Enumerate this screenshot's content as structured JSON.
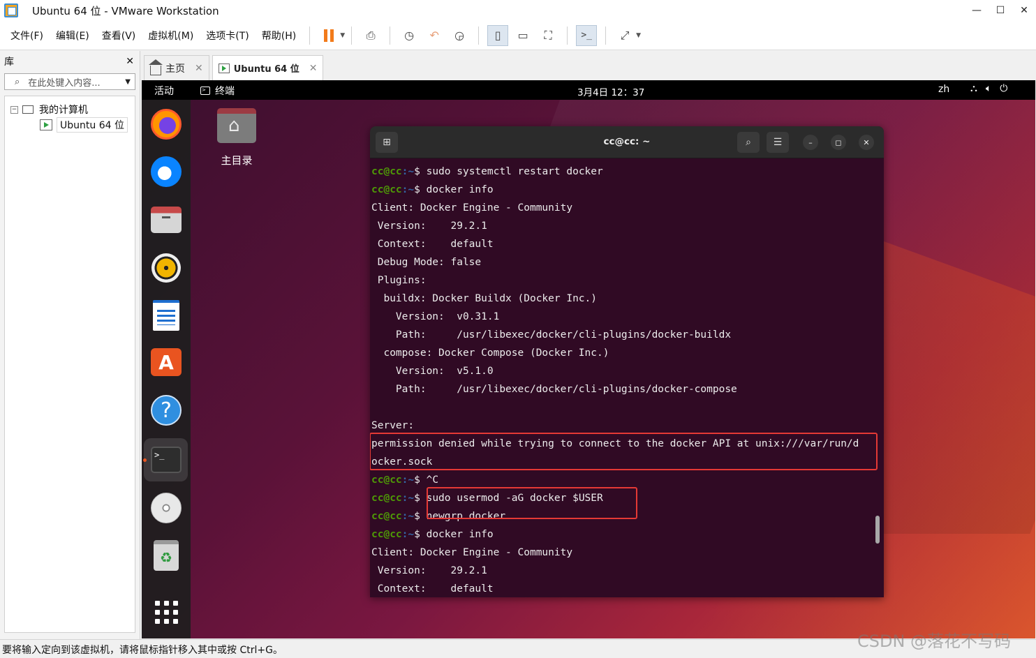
{
  "window": {
    "title": "Ubuntu 64 位 - VMware Workstation"
  },
  "menu": [
    "文件(F)",
    "编辑(E)",
    "查看(V)",
    "虚拟机(M)",
    "选项卡(T)",
    "帮助(H)"
  ],
  "library": {
    "title": "库",
    "search_placeholder": "在此处键入内容...",
    "tree_root": "我的计算机",
    "tree_vm": "Ubuntu 64 位"
  },
  "tabs": [
    {
      "label": "主页",
      "active": false
    },
    {
      "label": "Ubuntu 64 位",
      "active": true
    }
  ],
  "guest": {
    "activities": "活动",
    "app_name": "终端",
    "clock": "3月4日 12：37",
    "lang": "zh",
    "desktop_folder_label": "主目录",
    "dock_icons": [
      "firefox-icon",
      "thunderbird-icon",
      "files-icon",
      "rhythmbox-icon",
      "writer-icon",
      "app-center-icon",
      "help-icon",
      "terminal-icon",
      "disc-icon",
      "trash-icon",
      "show-apps-icon"
    ]
  },
  "terminal": {
    "title": "cc@cc: ~",
    "prompt_user": "cc@cc",
    "prompt_path": ":~$",
    "lines": [
      {
        "type": "cmd",
        "text": " sudo systemctl restart docker"
      },
      {
        "type": "cmd",
        "text": " docker info"
      },
      {
        "type": "out",
        "text": "Client: Docker Engine - Community"
      },
      {
        "type": "out",
        "text": " Version:    29.2.1"
      },
      {
        "type": "out",
        "text": " Context:    default"
      },
      {
        "type": "out",
        "text": " Debug Mode: false"
      },
      {
        "type": "out",
        "text": " Plugins:"
      },
      {
        "type": "out",
        "text": "  buildx: Docker Buildx (Docker Inc.)"
      },
      {
        "type": "out",
        "text": "    Version:  v0.31.1"
      },
      {
        "type": "out",
        "text": "    Path:     /usr/libexec/docker/cli-plugins/docker-buildx"
      },
      {
        "type": "out",
        "text": "  compose: Docker Compose (Docker Inc.)"
      },
      {
        "type": "out",
        "text": "    Version:  v5.1.0"
      },
      {
        "type": "out",
        "text": "    Path:     /usr/libexec/docker/cli-plugins/docker-compose"
      },
      {
        "type": "out",
        "text": ""
      },
      {
        "type": "out",
        "text": "Server:"
      },
      {
        "type": "out",
        "text": "permission denied while trying to connect to the docker API at unix:///var/run/d"
      },
      {
        "type": "out",
        "text": "ocker.sock"
      },
      {
        "type": "cmd",
        "text": " ^C"
      },
      {
        "type": "cmd",
        "text": " sudo usermod -aG docker $USER"
      },
      {
        "type": "cmd",
        "text": " newgrp docker"
      },
      {
        "type": "cmd",
        "text": " docker info"
      },
      {
        "type": "out",
        "text": "Client: Docker Engine - Community"
      },
      {
        "type": "out",
        "text": " Version:    29.2.1"
      },
      {
        "type": "out",
        "text": " Context:    default"
      }
    ]
  },
  "status_text": "要将输入定向到该虚拟机，请将鼠标指针移入其中或按 Ctrl+G。",
  "watermark": "CSDN @落花不写码"
}
